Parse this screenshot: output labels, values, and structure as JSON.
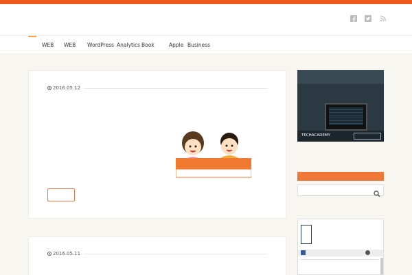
{
  "site": {
    "title": ""
  },
  "nav": {
    "items": [
      {
        "label": ""
      },
      {
        "label": "WEB"
      },
      {
        "label": "WEB"
      },
      {
        "label": "WordPress"
      },
      {
        "label": "Analytics"
      },
      {
        "label": "Book"
      },
      {
        "label": "Apple"
      },
      {
        "label": "Business"
      },
      {
        "label": ""
      }
    ]
  },
  "posts": [
    {
      "date": "2016.05.12",
      "title": "",
      "excerpt_p1": "",
      "excerpt_p2": "",
      "excerpt_p3": "",
      "readmore": "",
      "illustration_caption": "",
      "illustration_sub": ""
    },
    {
      "date": "2016.05.11",
      "title": ""
    }
  ],
  "sidebar": {
    "ad": {
      "line1": "",
      "line2": "",
      "line3": "",
      "brand": "TECHACADEMY",
      "cta": ""
    },
    "widget_title": "",
    "search_placeholder": "",
    "fb_banner_tag": "",
    "fb_banner_line1": "",
    "fb_banner_line2": ""
  },
  "colors": {
    "accent": "#f05a1e",
    "widget_head": "#f0793a"
  },
  "icons": [
    "facebook-icon",
    "twitter-icon",
    "rss-icon",
    "clock-icon",
    "search-icon"
  ]
}
